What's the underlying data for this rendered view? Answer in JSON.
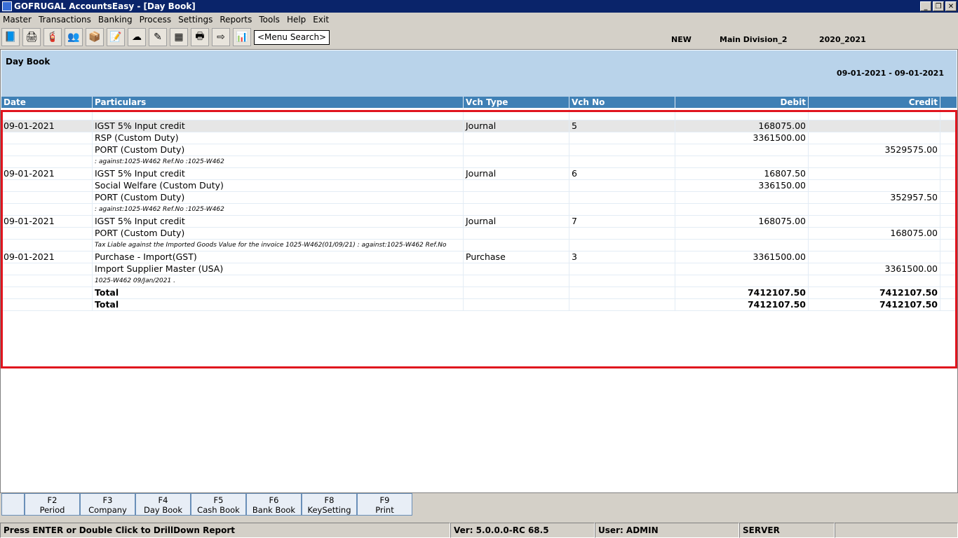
{
  "title": "GOFRUGAL AccountsEasy - [Day Book]",
  "window_buttons": [
    "_",
    "❐",
    "✕"
  ],
  "menu": [
    "Master",
    "Transactions",
    "Banking",
    "Process",
    "Settings",
    "Reports",
    "Tools",
    "Help",
    "Exit"
  ],
  "toolbar": {
    "icons": [
      "📘",
      "🖨",
      "🧯",
      "👥",
      "📦",
      "📝",
      "☁",
      "✎",
      "▦",
      "🖶",
      "⇨",
      "📊"
    ],
    "menu_search": "<Menu Search>"
  },
  "info": {
    "mode": "NEW",
    "division": "Main Division_2",
    "year": "2020_2021"
  },
  "report": {
    "title": "Day Book",
    "period": "09-01-2021 - 09-01-2021"
  },
  "columns": [
    "Date",
    "Particulars",
    "Vch Type",
    "Vch No",
    "Debit",
    "Credit"
  ],
  "rows": [
    [
      "",
      "",
      "",
      "",
      "",
      ""
    ],
    [
      "09-01-2021",
      "IGST 5% Input credit",
      "Journal",
      "5",
      "168075.00",
      ""
    ],
    [
      "",
      "RSP (Custom Duty)",
      "",
      "",
      "3361500.00",
      ""
    ],
    [
      "",
      "PORT (Custom Duty)",
      "",
      "",
      "",
      "3529575.00"
    ],
    [
      "",
      ": against:1025-W462 Ref.No :1025-W462",
      "",
      "",
      "",
      ""
    ],
    [
      "09-01-2021",
      "IGST 5% Input credit",
      "Journal",
      "6",
      "16807.50",
      ""
    ],
    [
      "",
      "Social Welfare (Custom Duty)",
      "",
      "",
      "336150.00",
      ""
    ],
    [
      "",
      "PORT (Custom Duty)",
      "",
      "",
      "",
      "352957.50"
    ],
    [
      "",
      ": against:1025-W462 Ref.No :1025-W462",
      "",
      "",
      "",
      ""
    ],
    [
      "09-01-2021",
      "IGST 5% Input credit",
      "Journal",
      "7",
      "168075.00",
      ""
    ],
    [
      "",
      "PORT (Custom Duty)",
      "",
      "",
      "",
      "168075.00"
    ],
    [
      "",
      "Tax Liable against the Imported Goods Value for the invoice 1025-W462(01/09/21) : against:1025-W462 Ref.No",
      "",
      "",
      "",
      ""
    ],
    [
      "09-01-2021",
      "Purchase - Import(GST)",
      "Purchase",
      "3",
      "3361500.00",
      ""
    ],
    [
      "",
      "Import Supplier Master (USA)",
      "",
      "",
      "",
      "3361500.00"
    ],
    [
      "",
      "1025-W462 09/Jan/2021 .",
      "",
      "",
      "",
      ""
    ],
    [
      "",
      "Total",
      "",
      "",
      "7412107.50",
      "7412107.50"
    ],
    [
      "",
      "Total",
      "",
      "",
      "7412107.50",
      "7412107.50"
    ]
  ],
  "fkeys": [
    {
      "k": "F2",
      "l": "Period"
    },
    {
      "k": "F3",
      "l": "Company"
    },
    {
      "k": "F4",
      "l": "Day Book"
    },
    {
      "k": "F5",
      "l": "Cash Book"
    },
    {
      "k": "F6",
      "l": "Bank Book"
    },
    {
      "k": "F8",
      "l": "KeySetting"
    },
    {
      "k": "F9",
      "l": "Print"
    }
  ],
  "status": [
    "Press ENTER or Double Click to DrillDown Report",
    "Ver: 5.0.0.0-RC 68.5",
    "User: ADMIN",
    "SERVER",
    ""
  ]
}
